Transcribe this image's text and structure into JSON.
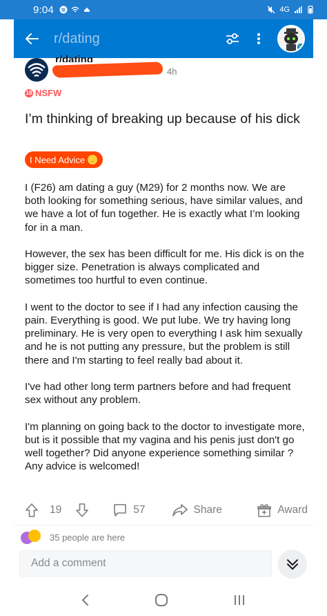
{
  "status_bar": {
    "time": "9:04",
    "network": "4G"
  },
  "app_bar": {
    "subreddit": "r/dating"
  },
  "post": {
    "subreddit_partial": "r/dating",
    "age": "4h",
    "nsfw_label": "NSFW",
    "title": "I’m thinking of breaking up because of his dick",
    "flair": "I Need Advice",
    "body": [
      "I (F26) am dating a guy (M29) for 2 months now. We are both looking for something serious, have similar values, and we have a lot of fun together. He is exactly what I’m looking for in a man.",
      "However, the sex has been difficult for me. His dick is on the bigger size. Penetration is always complicated and sometimes too hurtful to even continue.",
      "I went to the doctor to see if I had any infection causing the pain. Everything is good. We put lube. We try having long preliminary. He is very open to everything I ask him sexually and he is not putting any pressure, but the problem is still there and I'm starting to feel really bad about it.",
      "I've had other long term partners before and had frequent sex without any problem.",
      "I'm planning on going back to the doctor to investigate more, but is it possible that my vagina and his penis just don't go well together? Did anyone experience something similar ? Any advice is welcomed!"
    ]
  },
  "actions": {
    "votes": "19",
    "comments": "57",
    "share": "Share",
    "award": "Award"
  },
  "presence": {
    "text": "35 people are here"
  },
  "comment_box": {
    "placeholder": "Add a comment"
  },
  "colors": {
    "brand_blue": "#0079d3",
    "orange": "#ff4500",
    "nsfw": "#ff585b"
  }
}
